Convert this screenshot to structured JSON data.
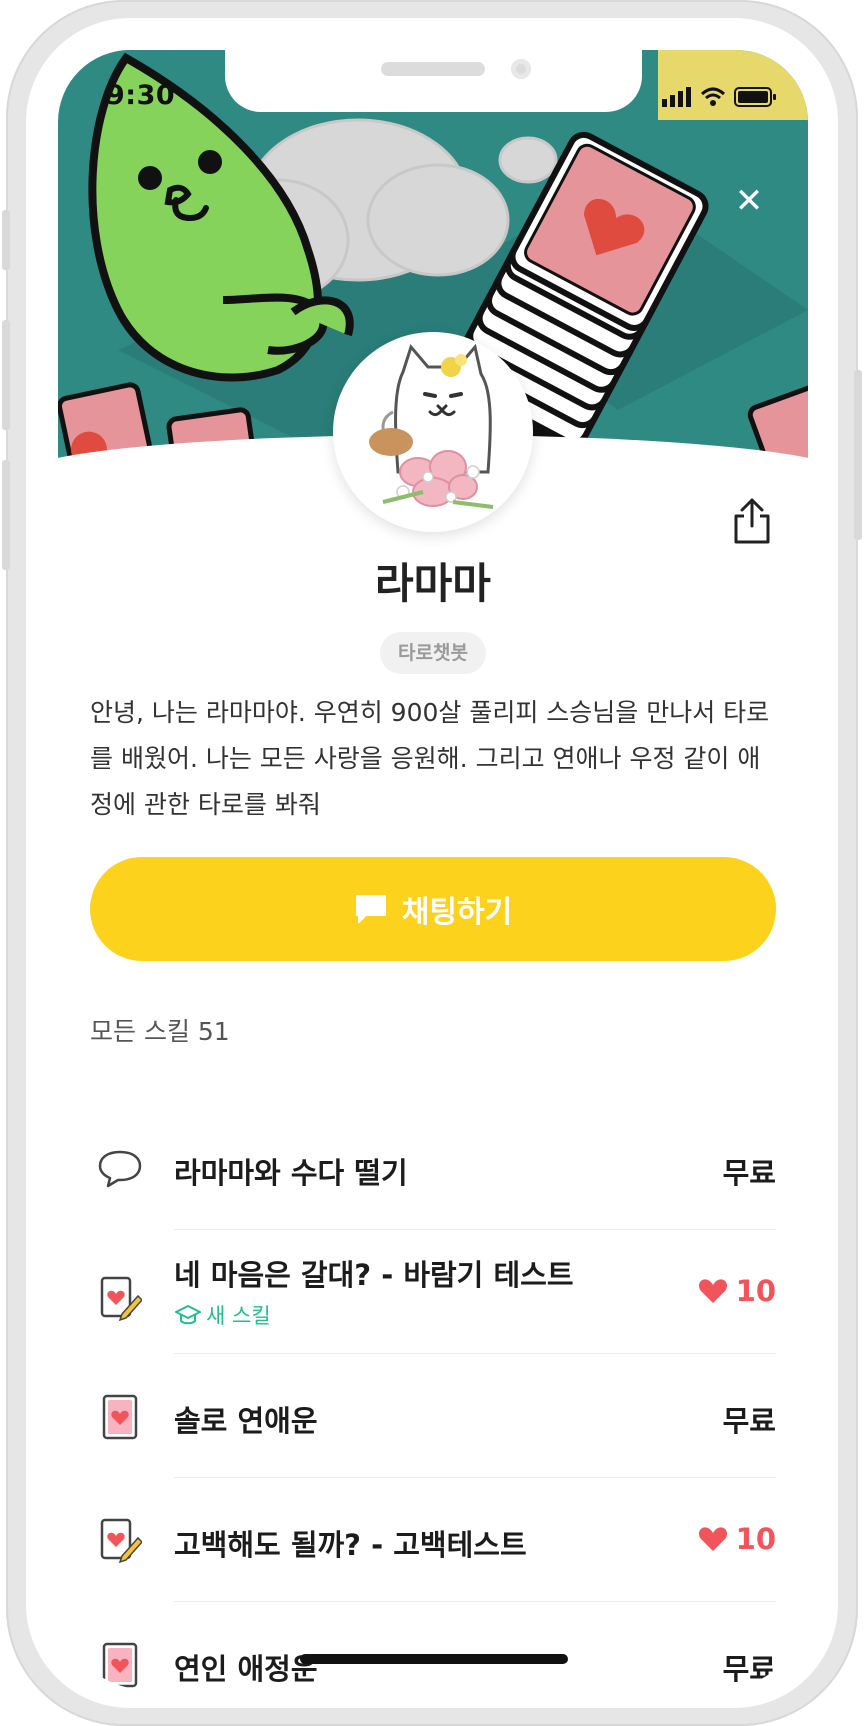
{
  "status": {
    "time": "9:30"
  },
  "hero": {
    "close_label": "✕"
  },
  "profile": {
    "name": "라마마",
    "tag": "타로챗봇",
    "description": "안녕, 나는 라마마야. 우연히 900살 풀리피 스승님을 만나서 타로를 배웠어. 나는 모든 사랑을 응원해. 그리고 연애나 우정 같이 애정에 관한 타로를 봐줘"
  },
  "chat_button": {
    "label": "채팅하기",
    "icon": "chat-bubble-icon"
  },
  "skills": {
    "header": "모든 스킬 51",
    "items": [
      {
        "icon": "speech-bubble-icon",
        "title": "라마마와 수다 떨기",
        "price": "무료"
      },
      {
        "icon": "card-pencil-icon",
        "title": "네 마음은 갈대? - 바람기 테스트",
        "price": "10",
        "badge": "새 스킬"
      },
      {
        "icon": "heart-card-icon",
        "title": "솔로 연애운",
        "price": "무료"
      },
      {
        "icon": "card-pencil-icon",
        "title": "고백해도 될까? - 고백테스트",
        "price": "10"
      },
      {
        "icon": "heart-card-icon",
        "title": "연인 애정운",
        "price": "무료"
      }
    ]
  },
  "colors": {
    "accent": "#fcd21c",
    "heart": "#f2545b",
    "new_badge": "#20bf8c",
    "hero_bg": "#2f8a84"
  }
}
